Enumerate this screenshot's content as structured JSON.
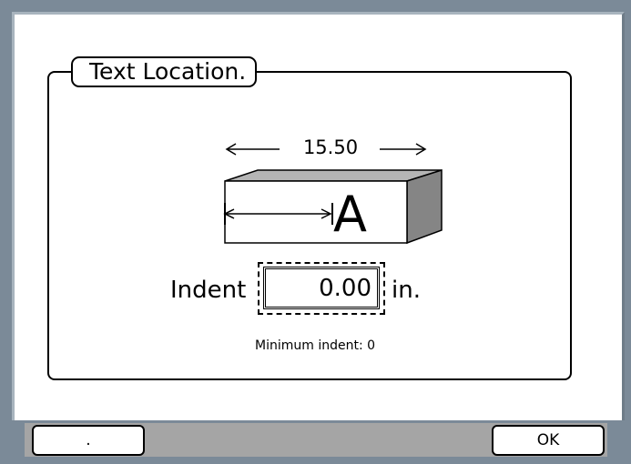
{
  "dialog": {
    "group_title": "Text Location.",
    "overall_length": "15.50",
    "letter": "A",
    "indent_label": "Indent",
    "indent_value": "0.00",
    "unit": "in.",
    "minimum_note": "Minimum indent: 0"
  },
  "softkeys": {
    "left_label": ".",
    "right_label": "OK"
  },
  "colors": {
    "frame": "#7b8a98",
    "screen_bg": "#ffffff",
    "softkey_bar": "#a5a5a5",
    "block_side": "#858585",
    "block_top": "#b5b5b5"
  }
}
